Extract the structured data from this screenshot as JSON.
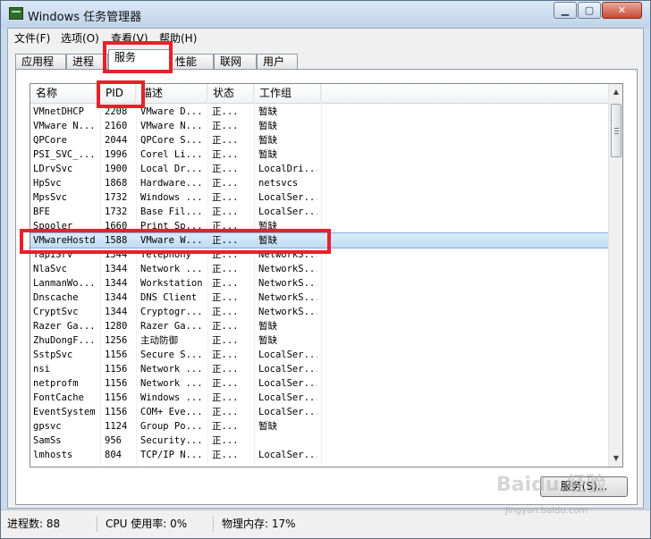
{
  "window": {
    "title": "Windows 任务管理器",
    "min_icon": "minimize-icon",
    "max_icon": "maximize-icon",
    "close_icon": "close-icon"
  },
  "menu": [
    "文件(F)",
    "选项(O)",
    "查看(V)",
    "帮助(H)"
  ],
  "tabs": [
    "应用程序",
    "进程",
    "服务",
    "性能",
    "联网",
    "用户"
  ],
  "active_tab": "服务",
  "columns": [
    "名称",
    "PID",
    "描述",
    "状态",
    "工作组"
  ],
  "rows": [
    [
      "VMnetDHCP",
      "2208",
      "VMware D...",
      "正...",
      "暂缺"
    ],
    [
      "VMware N...",
      "2160",
      "VMware N...",
      "正...",
      "暂缺"
    ],
    [
      "QPCore",
      "2044",
      "QPCore S...",
      "正...",
      "暂缺"
    ],
    [
      "PSI_SVC_...",
      "1996",
      "Corel Li...",
      "正...",
      "暂缺"
    ],
    [
      "LDrvSvc",
      "1900",
      "Local Dr...",
      "正...",
      "LocalDri..."
    ],
    [
      "HpSvc",
      "1868",
      "Hardware...",
      "正...",
      "netsvcs"
    ],
    [
      "MpsSvc",
      "1732",
      "Windows ...",
      "正...",
      "LocalSer..."
    ],
    [
      "BFE",
      "1732",
      "Base Fil...",
      "正...",
      "LocalSer..."
    ],
    [
      "Spooler",
      "1660",
      "Print Sp...",
      "正...",
      "暂缺"
    ],
    [
      "VMwareHostd",
      "1588",
      "VMware W...",
      "正...",
      "暂缺"
    ],
    [
      "TapiSrv",
      "1344",
      "Telephony",
      "正...",
      "NetworkS..."
    ],
    [
      "NlaSvc",
      "1344",
      "Network ...",
      "正...",
      "NetworkS..."
    ],
    [
      "LanmanWo...",
      "1344",
      "Workstation",
      "正...",
      "NetworkS..."
    ],
    [
      "Dnscache",
      "1344",
      "DNS Client",
      "正...",
      "NetworkS..."
    ],
    [
      "CryptSvc",
      "1344",
      "Cryptogr...",
      "正...",
      "NetworkS..."
    ],
    [
      "Razer Ga...",
      "1280",
      "Razer Ga...",
      "正...",
      "暂缺"
    ],
    [
      "ZhuDongF...",
      "1256",
      "主动防御",
      "正...",
      "暂缺"
    ],
    [
      "SstpSvc",
      "1156",
      "Secure S...",
      "正...",
      "LocalSer..."
    ],
    [
      "nsi",
      "1156",
      "Network ...",
      "正...",
      "LocalSer..."
    ],
    [
      "netprofm",
      "1156",
      "Network ...",
      "正...",
      "LocalSer..."
    ],
    [
      "FontCache",
      "1156",
      "Windows ...",
      "正...",
      "LocalSer..."
    ],
    [
      "EventSystem",
      "1156",
      "COM+ Eve...",
      "正...",
      "LocalSer..."
    ],
    [
      "gpsvc",
      "1124",
      "Group Po...",
      "正...",
      "暂缺"
    ],
    [
      "SamSs",
      "956",
      "Security...",
      "正...",
      ""
    ],
    [
      "lmhosts",
      "804",
      "TCP/IP N...",
      "正...",
      "LocalSer..."
    ]
  ],
  "selected_row": 9,
  "services_button": "服务(S)...",
  "status": {
    "processes": "进程数: 88",
    "cpu": "CPU 使用率: 0%",
    "memory": "物理内存: 17%"
  },
  "watermark": "Baidu 经验",
  "watermark_sub": "jingyan.baidu.com",
  "colors": {
    "highlight": "#e8202a",
    "selection": "#c1dcf3"
  }
}
